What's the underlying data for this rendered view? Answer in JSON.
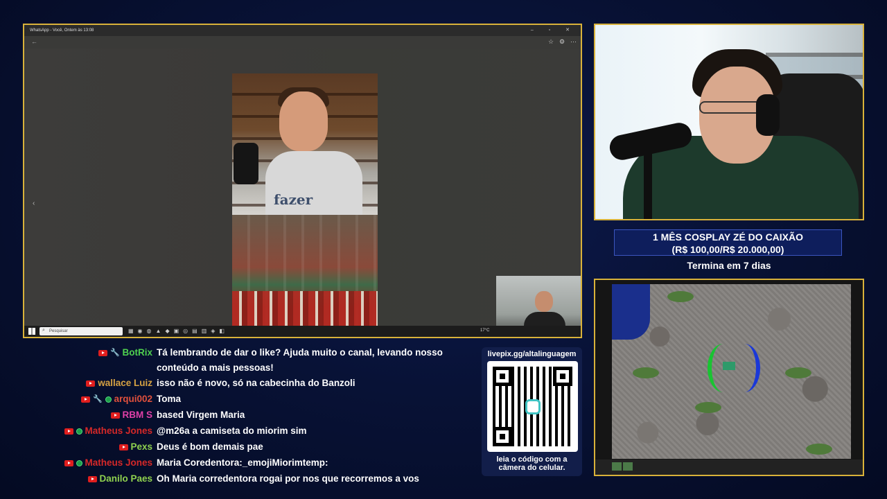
{
  "window": {
    "title": "WhatsApp - Você, Ontem às 13:08",
    "controls": "–  ▫  ✕"
  },
  "media": {
    "caption": "fazer"
  },
  "taskbar": {
    "search_placeholder": "Pesquisar",
    "temperature": "17°C"
  },
  "goal": {
    "line1": "1 MÊS COSPLAY ZÉ DO CAIXÃO",
    "line2": "(R$ 100,00/R$ 20.000,00)",
    "ends": "Termina em 7 dias"
  },
  "qr": {
    "url": "livepix.gg/altalinguagem",
    "footer_line1": "leia o código com a",
    "footer_line2": "câmera do celular."
  },
  "chat": {
    "messages": [
      {
        "user": "BotRix",
        "color": "#4fd14f",
        "badges": [
          "youtube",
          "wrench"
        ],
        "text": "Tá lembrando de dar o like? Ajuda muito o canal, levando nosso conteúdo a mais pessoas!"
      },
      {
        "user": "wallace Luiz",
        "color": "#d6a243",
        "badges": [
          "youtube"
        ],
        "text": "isso não é novo, só na cabecinha do Banzoli"
      },
      {
        "user": "arqui002",
        "color": "#e0503c",
        "badges": [
          "youtube",
          "wrench",
          "member"
        ],
        "text": "Toma"
      },
      {
        "user": "RBM S",
        "color": "#e040a8",
        "badges": [
          "youtube"
        ],
        "text": "based Virgem Maria"
      },
      {
        "user": "Matheus Jones",
        "color": "#d62828",
        "badges": [
          "youtube",
          "member"
        ],
        "text": "@m26a a camiseta do miorim sim"
      },
      {
        "user": "Pexs",
        "color": "#8fd14f",
        "badges": [
          "youtube"
        ],
        "text": "Deus é bom demais pae"
      },
      {
        "user": "Matheus Jones",
        "color": "#d62828",
        "badges": [
          "youtube",
          "member"
        ],
        "text": "Maria Coredentora:_emojiMiorimtemp:"
      },
      {
        "user": "Danilo Paes",
        "color": "#8fd14f",
        "badges": [
          "youtube"
        ],
        "text": "Oh Maria corredentora rogai por nos que recorremos a vos"
      }
    ]
  },
  "icons": [
    "back-arrow-icon",
    "star-icon",
    "settings-icon",
    "more-icon",
    "windows-start-icon",
    "search-icon",
    "youtube-icon",
    "wrench-icon",
    "member-badge-icon"
  ]
}
